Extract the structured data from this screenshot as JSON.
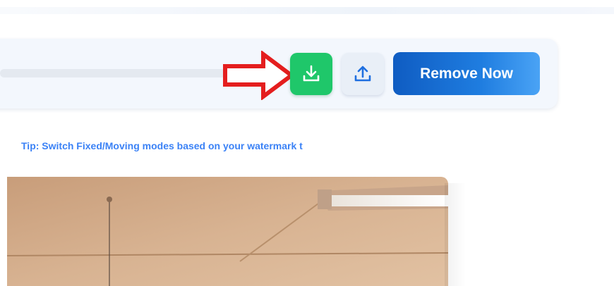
{
  "toolbar": {
    "download_icon": "download-icon",
    "upload_icon": "upload-icon",
    "remove_label": "Remove Now",
    "annotation_icon": "red-arrow-icon"
  },
  "tip": {
    "text": "Tip: Switch Fixed/Moving modes based on your watermark t"
  },
  "colors": {
    "download_button": "#1fc76a",
    "remove_button": "#1f7de0",
    "tip_text": "#3b82f6",
    "arrow": "#e41e1e"
  }
}
